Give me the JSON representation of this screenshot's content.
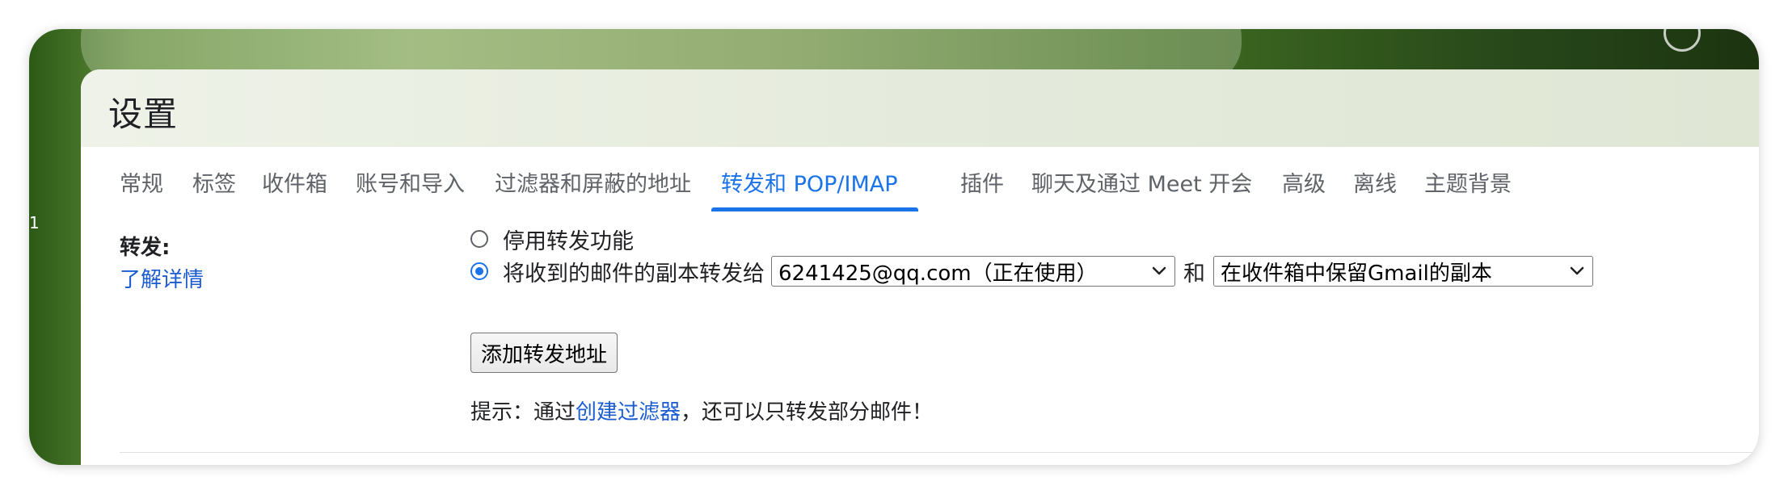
{
  "page": {
    "title": "设置",
    "side_marker": "1"
  },
  "tabs": [
    {
      "label": "常规",
      "active": false
    },
    {
      "label": "标签",
      "active": false
    },
    {
      "label": "收件箱",
      "active": false
    },
    {
      "label": "账号和导入",
      "active": false
    },
    {
      "label": "过滤器和屏蔽的地址",
      "active": false
    },
    {
      "label": "转发和 POP/IMAP",
      "active": true
    },
    {
      "label": "插件",
      "active": false
    },
    {
      "label": "聊天及通过 Meet 开会",
      "active": false
    },
    {
      "label": "高级",
      "active": false
    },
    {
      "label": "离线",
      "active": false
    },
    {
      "label": "主题背景",
      "active": false
    }
  ],
  "forwarding": {
    "section_label": "转发:",
    "learn_more": "了解详情",
    "option_disable": "停用转发功能",
    "option_forward": "将收到的邮件的副本转发给",
    "selected_option": "forward",
    "forward_address": "6241425@qq.com（正在使用）",
    "and_text": "和",
    "copy_action": "在收件箱中保留Gmail的副本",
    "add_button": "添加转发地址",
    "hint_prefix": "提示：通过",
    "hint_link": "创建过滤器",
    "hint_suffix": "，还可以只转发部分邮件！"
  },
  "colors": {
    "accent": "#1a73e8",
    "link": "#1a5bcf",
    "tab_text": "#5f6368"
  },
  "icons": {
    "radio": "radio-button",
    "dropdown": "chevron-down-icon"
  }
}
